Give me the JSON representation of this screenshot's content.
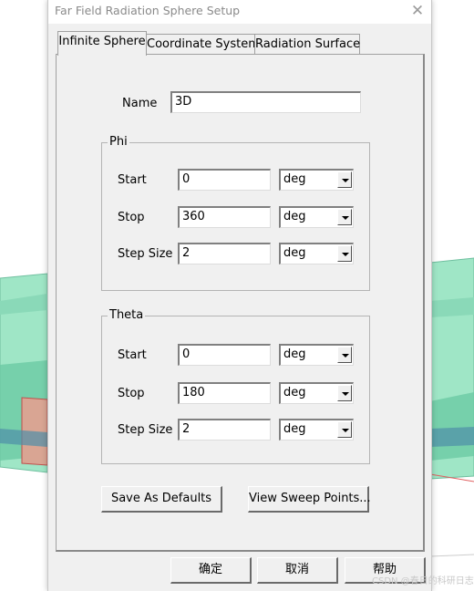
{
  "window": {
    "title": "Far Field Radiation Sphere Setup",
    "close_glyph": "✕"
  },
  "tabs": [
    {
      "label": "Infinite Sphere",
      "active": true
    },
    {
      "label": "Coordinate System",
      "active": false
    },
    {
      "label": "Radiation Surface",
      "active": false
    }
  ],
  "name_field": {
    "label": "Name",
    "value": "3D"
  },
  "phi": {
    "title": "Phi",
    "start": {
      "label": "Start",
      "value": "0",
      "unit": "deg"
    },
    "stop": {
      "label": "Stop",
      "value": "360",
      "unit": "deg"
    },
    "step": {
      "label": "Step Size",
      "value": "2",
      "unit": "deg"
    }
  },
  "theta": {
    "title": "Theta",
    "start": {
      "label": "Start",
      "value": "0",
      "unit": "deg"
    },
    "stop": {
      "label": "Stop",
      "value": "180",
      "unit": "deg"
    },
    "step": {
      "label": "Step Size",
      "value": "2",
      "unit": "deg"
    }
  },
  "buttons": {
    "save_defaults": "Save As Defaults",
    "view_sweep": "View Sweep Points...",
    "ok": "确定",
    "cancel": "取消",
    "help": "帮助"
  },
  "watermark": "CSDN @春日的科研日志",
  "colors": {
    "background_shape": "#7fe0b4",
    "dialog_face": "#f0f0f0",
    "accent_red": "#c0504d"
  }
}
